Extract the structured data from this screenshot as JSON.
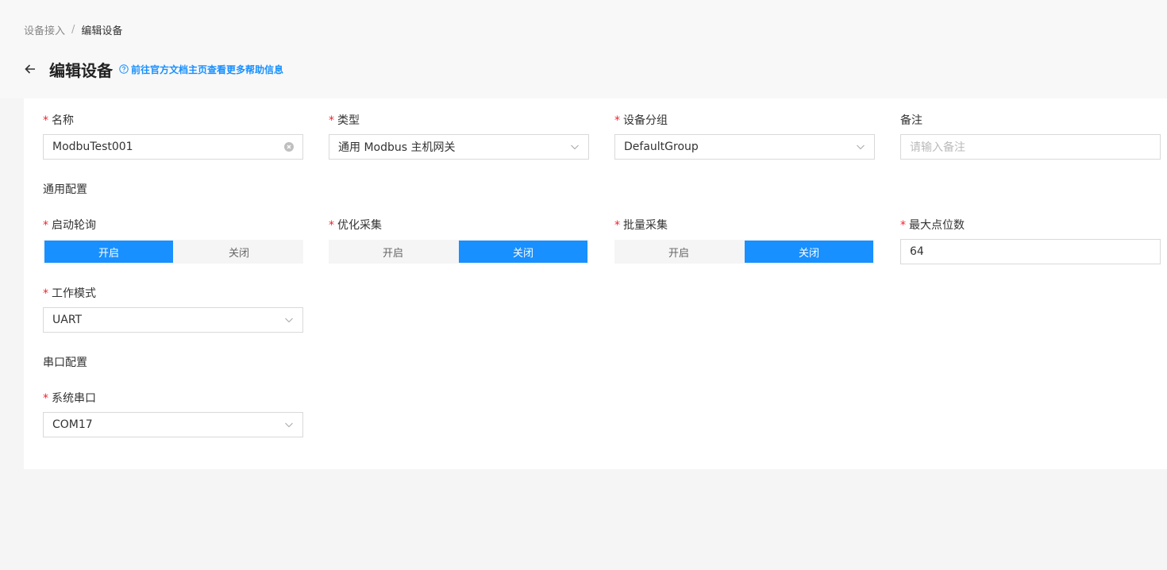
{
  "breadcrumb": {
    "parent": "设备接入",
    "separator": "/",
    "current": "编辑设备"
  },
  "header": {
    "title": "编辑设备",
    "help_link": "前往官方文档主页查看更多帮助信息"
  },
  "form": {
    "name": {
      "label": "名称",
      "required": "*",
      "value": "ModbuTest001"
    },
    "type": {
      "label": "类型",
      "required": "*",
      "value": "通用 Modbus 主机网关"
    },
    "group": {
      "label": "设备分组",
      "required": "*",
      "value": "DefaultGroup"
    },
    "remark": {
      "label": "备注",
      "placeholder": "请输入备注"
    },
    "general_section": "通用配置",
    "polling": {
      "label": "启动轮询",
      "required": "*",
      "on": "开启",
      "off": "关闭",
      "selected": "on"
    },
    "optimize": {
      "label": "优化采集",
      "required": "*",
      "on": "开启",
      "off": "关闭",
      "selected": "off"
    },
    "batch": {
      "label": "批量采集",
      "required": "*",
      "on": "开启",
      "off": "关闭",
      "selected": "off"
    },
    "max_points": {
      "label": "最大点位数",
      "required": "*",
      "value": "64"
    },
    "work_mode": {
      "label": "工作模式",
      "required": "*",
      "value": "UART"
    },
    "serial_section": "串口配置",
    "serial_port": {
      "label": "系统串口",
      "required": "*",
      "value": "COM17"
    }
  },
  "colors": {
    "accent": "#1890ff",
    "required": "#f5222d",
    "border": "#d9d9d9"
  },
  "icons": {
    "back": "arrow-left-icon",
    "help": "question-circle-icon",
    "clear": "close-circle-icon",
    "select": "chevron-down-icon"
  }
}
